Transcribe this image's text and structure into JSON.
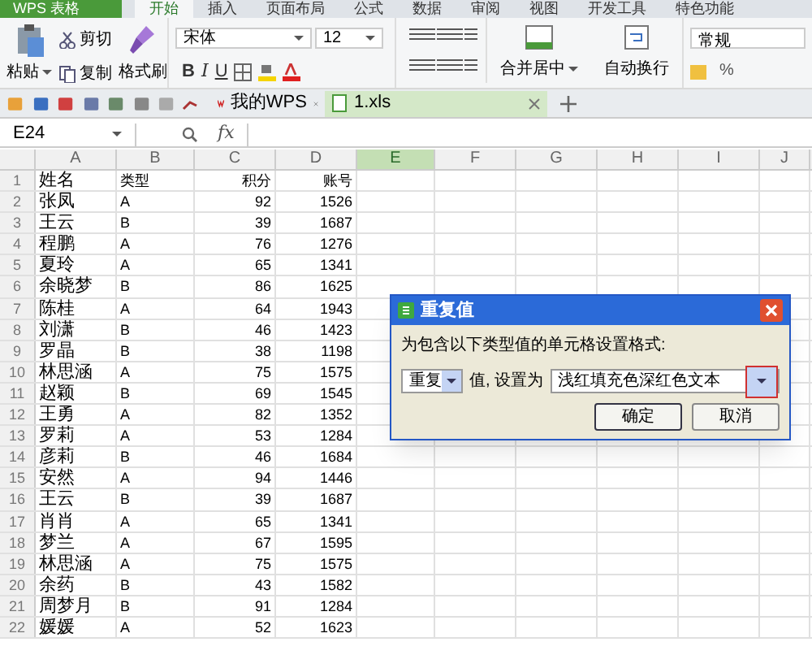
{
  "app_button": "WPS 表格",
  "menu_tabs": [
    {
      "label": "开始",
      "selected": true
    },
    {
      "label": "插入",
      "selected": false
    },
    {
      "label": "页面布局",
      "selected": false
    },
    {
      "label": "公式",
      "selected": false
    },
    {
      "label": "数据",
      "selected": false
    },
    {
      "label": "审阅",
      "selected": false
    },
    {
      "label": "视图",
      "selected": false
    },
    {
      "label": "开发工具",
      "selected": false
    },
    {
      "label": "特色功能",
      "selected": false
    }
  ],
  "ribbon": {
    "paste": "粘贴",
    "cut": "剪切",
    "copy": "复制",
    "format_painter": "格式刷",
    "font": "宋体",
    "font_size": "12",
    "style_buttons": [
      "B",
      "I",
      "U"
    ],
    "merge": "合并居中",
    "wrap": "自动换行",
    "number_format": "常规",
    "percent": "%"
  },
  "doc_tabs": [
    {
      "label": "我的WPS",
      "selected": false
    },
    {
      "label": "1.xls",
      "selected": true
    }
  ],
  "name_box": "E24",
  "fx": "fx",
  "columns": [
    {
      "label": "A",
      "selected": false
    },
    {
      "label": "B",
      "selected": false
    },
    {
      "label": "C",
      "selected": false
    },
    {
      "label": "D",
      "selected": false
    },
    {
      "label": "E",
      "selected": true
    },
    {
      "label": "F",
      "selected": false
    },
    {
      "label": "G",
      "selected": false
    },
    {
      "label": "H",
      "selected": false
    },
    {
      "label": "I",
      "selected": false
    },
    {
      "label": "J",
      "selected": false
    }
  ],
  "rows": [
    {
      "number": "1",
      "cells": [
        "姓名",
        "类型",
        "积分",
        "账号"
      ]
    },
    {
      "number": "2",
      "cells": [
        "张凤",
        "A",
        "92",
        "1526"
      ]
    },
    {
      "number": "3",
      "cells": [
        "王云",
        "B",
        "39",
        "1687"
      ]
    },
    {
      "number": "4",
      "cells": [
        "程鹏",
        "A",
        "76",
        "1276"
      ]
    },
    {
      "number": "5",
      "cells": [
        "夏玲",
        "A",
        "65",
        "1341"
      ]
    },
    {
      "number": "6",
      "cells": [
        "余晓梦",
        "B",
        "86",
        "1625"
      ]
    },
    {
      "number": "7",
      "cells": [
        "陈桂",
        "A",
        "64",
        "1943"
      ]
    },
    {
      "number": "8",
      "cells": [
        "刘潇",
        "B",
        "46",
        "1423"
      ]
    },
    {
      "number": "9",
      "cells": [
        "罗晶",
        "B",
        "38",
        "1198"
      ]
    },
    {
      "number": "10",
      "cells": [
        "林思涵",
        "A",
        "75",
        "1575"
      ]
    },
    {
      "number": "11",
      "cells": [
        "赵颖",
        "B",
        "69",
        "1545"
      ]
    },
    {
      "number": "12",
      "cells": [
        "王勇",
        "A",
        "82",
        "1352"
      ]
    },
    {
      "number": "13",
      "cells": [
        "罗莉",
        "A",
        "53",
        "1284"
      ]
    },
    {
      "number": "14",
      "cells": [
        "彦莉",
        "B",
        "46",
        "1684"
      ]
    },
    {
      "number": "15",
      "cells": [
        "安然",
        "A",
        "94",
        "1446"
      ]
    },
    {
      "number": "16",
      "cells": [
        "王云",
        "B",
        "39",
        "1687"
      ]
    },
    {
      "number": "17",
      "cells": [
        "肖肖",
        "A",
        "65",
        "1341"
      ]
    },
    {
      "number": "18",
      "cells": [
        "梦兰",
        "A",
        "67",
        "1595"
      ]
    },
    {
      "number": "19",
      "cells": [
        "林思涵",
        "A",
        "75",
        "1575"
      ]
    },
    {
      "number": "20",
      "cells": [
        "余药",
        "B",
        "43",
        "1582"
      ]
    },
    {
      "number": "21",
      "cells": [
        "周梦月",
        "B",
        "91",
        "1284"
      ]
    },
    {
      "number": "22",
      "cells": [
        "媛媛",
        "A",
        "52",
        "1623"
      ]
    }
  ],
  "dialog": {
    "title": "重复值",
    "prompt": "为包含以下类型值的单元格设置格式:",
    "rule": "重复",
    "value_label": "值, 设置为",
    "format": "浅红填充色深红色文本",
    "buttons": [
      "确定",
      "取消"
    ]
  }
}
